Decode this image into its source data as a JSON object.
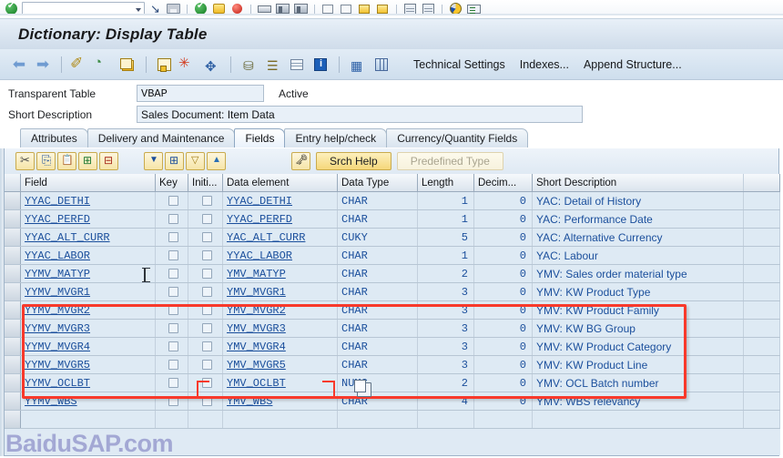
{
  "window": {
    "title": "Dictionary: Display Table"
  },
  "system_toolbar": {
    "command_field_value": "",
    "command_field_placeholder": "",
    "icons": [
      "enter-green-check-icon",
      "command-field",
      "back-arrow-icon",
      "save-disk-icon",
      "back-green-icon",
      "exit-yellow-icon",
      "cancel-red-icon",
      "print-icon",
      "find-icon",
      "find-next-icon",
      "first-page-icon",
      "previous-page-icon",
      "next-page-icon",
      "last-page-icon",
      "create-mode-icon",
      "display-mode-icon",
      "help-icon",
      "customize-layout-icon"
    ]
  },
  "app_toolbar": {
    "icons": [
      "back-arrow-icon",
      "forward-arrow-icon",
      "change-pencil-icon",
      "refresh-icon",
      "copy-object-icon",
      "where-used-list-icon",
      "highlight-star-icon",
      "expand-blue-icon",
      "hierarchy-icon",
      "stack-display-icon",
      "table-display-icon",
      "info-blue-icon",
      "structure-icon",
      "grid-columns-icon"
    ],
    "buttons": [
      {
        "label": "Technical Settings",
        "name": "technical-settings-button"
      },
      {
        "label": "Indexes...",
        "name": "indexes-button"
      },
      {
        "label": "Append Structure...",
        "name": "append-structure-button"
      }
    ]
  },
  "form": {
    "table_type_label": "Transparent Table",
    "table_name_value": "VBAP",
    "status": "Active",
    "short_description_label": "Short Description",
    "short_description_value": "Sales Document: Item Data"
  },
  "tabs": [
    {
      "label": "Attributes",
      "active": false
    },
    {
      "label": "Delivery and Maintenance",
      "active": false
    },
    {
      "label": "Fields",
      "active": true
    },
    {
      "label": "Entry help/check",
      "active": false
    },
    {
      "label": "Currency/Quantity Fields",
      "active": false
    }
  ],
  "panel_toolbar": {
    "icons": [
      "cut-scissors-icon",
      "copy-icon",
      "paste-icon",
      "insert-row-icon",
      "delete-row-icon",
      "filter-down-icon",
      "select-all-icon",
      "deselect-all-icon",
      "sort-up-icon",
      "key-predefined-icon"
    ],
    "buttons": [
      {
        "label": "Srch Help",
        "name": "srch-help-button",
        "disabled": false
      },
      {
        "label": "Predefined Type",
        "name": "predefined-type-button",
        "disabled": true
      }
    ]
  },
  "grid": {
    "columns": [
      "Field",
      "Key",
      "Initi...",
      "Data element",
      "Data Type",
      "Length",
      "Decim...",
      "Short Description"
    ],
    "rows": [
      {
        "field": "YYAC_DETHI",
        "key": false,
        "init": false,
        "data_element": "YYAC_DETHI",
        "data_type": "CHAR",
        "length": "1",
        "decimals": "0",
        "description": "YAC: Detail of History",
        "highlighted": false
      },
      {
        "field": "YYAC_PERFD",
        "key": false,
        "init": false,
        "data_element": "YYAC_PERFD",
        "data_type": "CHAR",
        "length": "1",
        "decimals": "0",
        "description": "YAC: Performance Date",
        "highlighted": false
      },
      {
        "field": "YYAC_ALT_CURR",
        "key": false,
        "init": false,
        "data_element": "YAC_ALT_CURR",
        "data_type": "CUKY",
        "length": "5",
        "decimals": "0",
        "description": "YAC: Alternative Currency",
        "highlighted": false
      },
      {
        "field": "YYAC_LABOR",
        "key": false,
        "init": false,
        "data_element": "YYAC_LABOR",
        "data_type": "CHAR",
        "length": "1",
        "decimals": "0",
        "description": "YAC: Labour",
        "highlighted": false
      },
      {
        "field": "YYMV_MATYP",
        "key": false,
        "init": false,
        "data_element": "YMV_MATYP",
        "data_type": "CHAR",
        "length": "2",
        "decimals": "0",
        "description": "YMV: Sales order material type",
        "highlighted": false
      },
      {
        "field": "YYMV_MVGR1",
        "key": false,
        "init": false,
        "data_element": "YMV_MVGR1",
        "data_type": "CHAR",
        "length": "3",
        "decimals": "0",
        "description": "YMV: KW Product Type",
        "highlighted": true
      },
      {
        "field": "YYMV_MVGR2",
        "key": false,
        "init": false,
        "data_element": "YMV_MVGR2",
        "data_type": "CHAR",
        "length": "3",
        "decimals": "0",
        "description": "YMV: KW Product Family",
        "highlighted": true
      },
      {
        "field": "YYMV_MVGR3",
        "key": false,
        "init": false,
        "data_element": "YMV_MVGR3",
        "data_type": "CHAR",
        "length": "3",
        "decimals": "0",
        "description": "YMV: KW BG Group",
        "highlighted": true
      },
      {
        "field": "YYMV_MVGR4",
        "key": false,
        "init": false,
        "data_element": "YMV_MVGR4",
        "data_type": "CHAR",
        "length": "3",
        "decimals": "0",
        "description": "YMV: KW Product Category",
        "highlighted": true
      },
      {
        "field": "YYMV_MVGR5",
        "key": false,
        "init": false,
        "data_element": "YMV_MVGR5",
        "data_type": "CHAR",
        "length": "3",
        "decimals": "0",
        "description": "YMV: KW Product Line",
        "highlighted": true
      },
      {
        "field": "YYMV_OCLBT",
        "key": false,
        "init": false,
        "data_element": "YMV_OCLBT",
        "data_type": "NUMC",
        "length": "2",
        "decimals": "0",
        "description": "YMV: OCL Batch number",
        "highlighted": false
      },
      {
        "field": "YYMV_WBS",
        "key": false,
        "init": false,
        "data_element": "YMV_WBS",
        "data_type": "CHAR",
        "length": "4",
        "decimals": "0",
        "description": "YMV: WBS relevancy",
        "highlighted": false
      },
      {
        "field": "",
        "key": null,
        "init": null,
        "data_element": "",
        "data_type": "",
        "length": "",
        "decimals": "",
        "description": "",
        "highlighted": false
      }
    ]
  },
  "annotation": {
    "watermark": "BaiduSAP.com",
    "box_color": "#f8392b"
  }
}
